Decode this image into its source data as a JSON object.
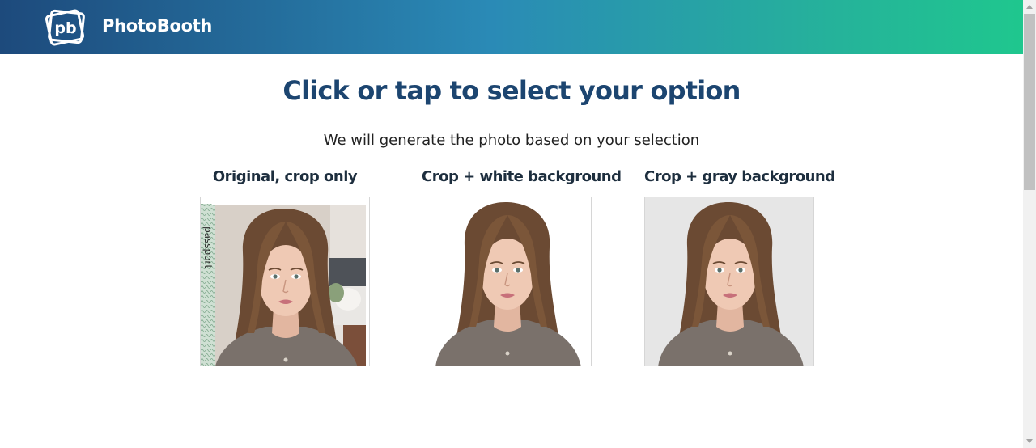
{
  "header": {
    "brand": "PhotoBooth"
  },
  "main": {
    "title": "Click or tap to select your option",
    "subtitle": "We will generate the photo based on your selection",
    "options": [
      {
        "label": "Original, crop only"
      },
      {
        "label": "Crop + white background"
      },
      {
        "label": "Crop + gray background"
      }
    ]
  },
  "photo": {
    "passport_text": "passport"
  },
  "colors": {
    "gradient_start": "#1d4a7c",
    "gradient_mid": "#2a8ab6",
    "gradient_end": "#1fc78e",
    "title": "#1c4570",
    "gray_background": "#e6e6e6",
    "white_background": "#ffffff"
  },
  "icons": {
    "logo": "pb-logo-icon",
    "scroll_up": "arrow-up-icon",
    "scroll_down": "arrow-down-icon"
  }
}
